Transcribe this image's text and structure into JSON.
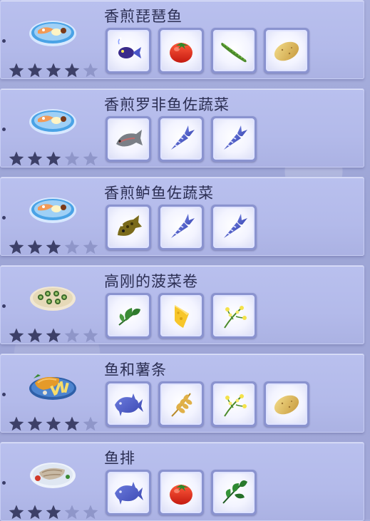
{
  "recipes": [
    {
      "name": "香煎琵琶鱼",
      "dish_icon": "seafood-plate-icon",
      "rating": 4,
      "max_rating": 5,
      "ingredients": [
        "purple-fish-icon",
        "tomato-icon",
        "cucumber-icon",
        "potato-icon"
      ]
    },
    {
      "name": "香煎罗非鱼佐蔬菜",
      "dish_icon": "seafood-plate-icon",
      "rating": 3,
      "max_rating": 5,
      "ingredients": [
        "tilapia-icon",
        "carrot-icon",
        "carrot-icon"
      ]
    },
    {
      "name": "香煎鲈鱼佐蔬菜",
      "dish_icon": "seafood-plate-icon",
      "rating": 3,
      "max_rating": 5,
      "ingredients": [
        "bass-fish-icon",
        "carrot-icon",
        "carrot-icon"
      ]
    },
    {
      "name": "高刚的菠菜卷",
      "dish_icon": "spinach-rolls-plate-icon",
      "rating": 3,
      "max_rating": 5,
      "ingredients": [
        "spinach-icon",
        "cheese-icon",
        "flower-herb-icon"
      ]
    },
    {
      "name": "鱼和薯条",
      "dish_icon": "fish-and-chips-plate-icon",
      "rating": 4,
      "max_rating": 5,
      "ingredients": [
        "fish-category-icon",
        "wheat-icon",
        "flower-herb-icon",
        "potato-icon"
      ]
    },
    {
      "name": "鱼排",
      "dish_icon": "fish-steak-plate-icon",
      "rating": 3,
      "max_rating": 5,
      "ingredients": [
        "fish-category-icon",
        "tomato-icon",
        "basil-icon"
      ]
    }
  ],
  "colors": {
    "star_filled": "#3d4068",
    "star_empty": "#8f96c9",
    "card_bg": "#b7bdec",
    "slot_frame": "#8a93cf",
    "category_icon": "#4a58c4"
  }
}
